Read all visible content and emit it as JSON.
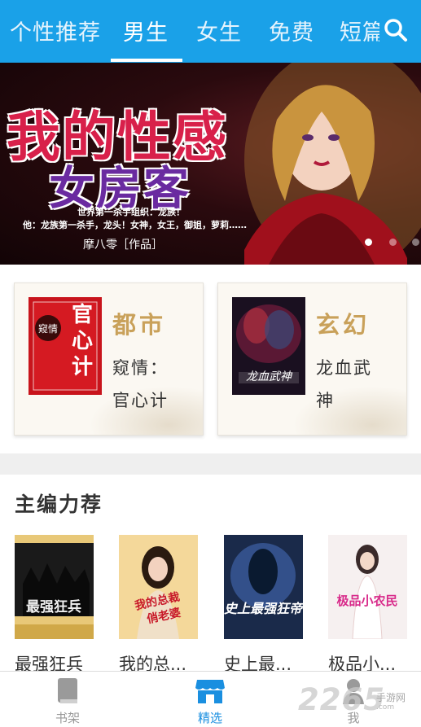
{
  "tabs": [
    {
      "label": "个性推荐",
      "active": false
    },
    {
      "label": "男生",
      "active": true
    },
    {
      "label": "女生",
      "active": false
    },
    {
      "label": "免费",
      "active": false
    },
    {
      "label": "短篇",
      "active": false
    }
  ],
  "search_icon": "search-icon",
  "banner": {
    "title_line1": "我的性感",
    "title_line2": "女房客",
    "subtitle_line1": "世界第一杀手组织：龙族！",
    "subtitle_line2": "他：龙族第一杀手，龙头！女神，女王，御姐，萝莉……",
    "author": "摩八零［作品］",
    "page_count": 3,
    "active_page": 1
  },
  "categories": [
    {
      "genre": "都市",
      "book_title": "窥情：官心计",
      "cover_text": "官心计",
      "cover_tag": "窥情"
    },
    {
      "genre": "玄幻",
      "book_title": "龙血武神",
      "cover_text": "龙血武神"
    }
  ],
  "picks": {
    "title": "主编力荐",
    "books": [
      {
        "name": "最强狂兵",
        "cover_text": "最强狂兵"
      },
      {
        "name": "我的总...",
        "cover_text": "我的总裁俏老婆"
      },
      {
        "name": "史上最...",
        "cover_text": "史上最强狂帝"
      },
      {
        "name": "极品小...",
        "cover_text": "极品小农民"
      }
    ]
  },
  "bottom_nav": [
    {
      "label": "书架",
      "icon": "book-icon",
      "active": false
    },
    {
      "label": "精选",
      "icon": "store-icon",
      "active": true
    },
    {
      "label": "我",
      "icon": "user-icon",
      "active": false
    }
  ],
  "watermark": {
    "text": "2265",
    "domain": ".com",
    "site": "手游网"
  },
  "colors": {
    "accent": "#1aa1e8",
    "nav_active": "#1a8fe0",
    "genre": "#c9a15a"
  }
}
